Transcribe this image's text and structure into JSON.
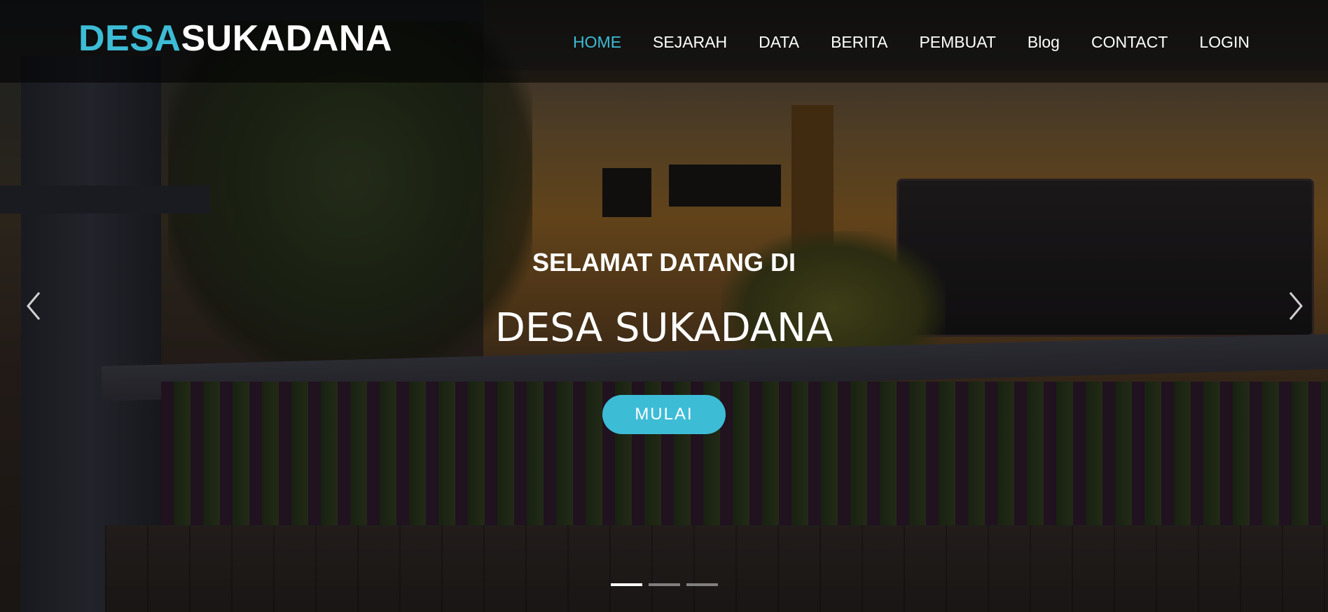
{
  "brand": {
    "part1": "DESA",
    "part2": "SUKADANA",
    "accent_color": "#3dbcd6"
  },
  "nav": {
    "items": [
      {
        "label": "HOME",
        "active": true
      },
      {
        "label": "SEJARAH",
        "active": false
      },
      {
        "label": "DATA",
        "active": false
      },
      {
        "label": "BERITA",
        "active": false
      },
      {
        "label": "PEMBUAT",
        "active": false
      },
      {
        "label": "Blog",
        "active": false
      },
      {
        "label": "CONTACT",
        "active": false
      },
      {
        "label": "LOGIN",
        "active": false
      }
    ]
  },
  "hero": {
    "subtitle": "SELAMAT DATANG DI",
    "title": "DESA SUKADANA",
    "cta_label": "MULAI",
    "cta_color": "#3dbcd6",
    "prev_icon": "chevron-left-icon",
    "next_icon": "chevron-right-icon",
    "slide_count": 3,
    "active_slide": 1
  }
}
